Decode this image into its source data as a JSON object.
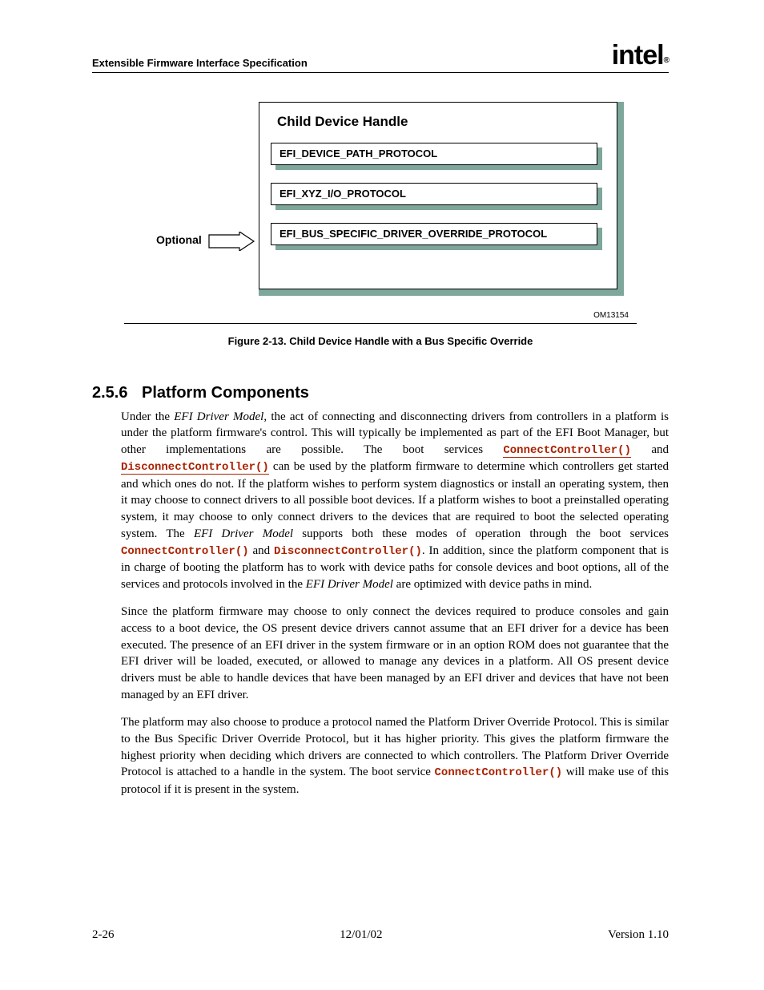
{
  "header": {
    "doc_title": "Extensible Firmware Interface Specification",
    "logo_text": "intel"
  },
  "figure": {
    "optional_label": "Optional",
    "panel_title": "Child Device Handle",
    "protocols": {
      "p1": "EFI_DEVICE_PATH_PROTOCOL",
      "p2": "EFI_XYZ_I/O_PROTOCOL",
      "p3": "EFI_BUS_SPECIFIC_DRIVER_OVERRIDE_PROTOCOL"
    },
    "om_code": "OM13154",
    "caption": "Figure 2-13.  Child Device Handle with a Bus Specific Override"
  },
  "section": {
    "number": "2.5.6",
    "title": "Platform Components"
  },
  "body": {
    "p1a": "Under the ",
    "p1_em1": "EFI Driver Model",
    "p1b": ", the act of connecting and disconnecting drivers from controllers in a platform is under the platform firmware's control.  This will typically be implemented as part of the EFI Boot Manager, but other implementations are possible.  The boot services ",
    "p1_code1": "ConnectController()",
    "p1c": " and ",
    "p1_code2": "DisconnectController()",
    "p1d": " can be used by the platform firmware to determine which controllers get started and which ones do not.  If the platform wishes to perform system diagnostics or install an operating system, then it may choose to connect drivers to all possible boot devices.  If a platform wishes to boot a preinstalled operating system, it may choose to only connect drivers to the devices that are required to boot the selected operating system.  The ",
    "p1_em2": "EFI Driver Model",
    "p1e": " supports both these modes of operation through the boot services ",
    "p1_code3": "ConnectController()",
    "p1f": " and ",
    "p1_code4": "DisconnectController()",
    "p1g": ".  In addition, since the platform component that is in charge of booting the platform has to work with device paths for console devices and boot options, all of the services and protocols involved in the ",
    "p1_em3": "EFI Driver Model",
    "p1h": " are optimized with device paths in mind.",
    "p2": "Since the platform firmware may choose to only connect the devices required to produce consoles and gain access to a boot device, the OS present device drivers cannot assume that an EFI driver for a device has been executed.  The presence of an EFI driver in the system firmware or in an option ROM does not guarantee that the EFI driver will be loaded, executed, or allowed to manage any devices in a platform.  All OS present device drivers must be able to handle devices that have been managed by an EFI driver and devices that have not been managed by an EFI driver.",
    "p3a": "The platform may also choose to produce a protocol named the Platform Driver Override Protocol.  This is similar to the Bus Specific Driver Override Protocol, but it has higher priority.  This gives the platform firmware the highest priority when deciding which drivers are connected to which controllers.  The Platform Driver Override Protocol is attached to a handle in the system.  The boot service ",
    "p3_code1": "ConnectController()",
    "p3b": " will make use of this protocol if it is present in the system."
  },
  "footer": {
    "page": "2-26",
    "date": "12/01/02",
    "version": "Version 1.10"
  }
}
